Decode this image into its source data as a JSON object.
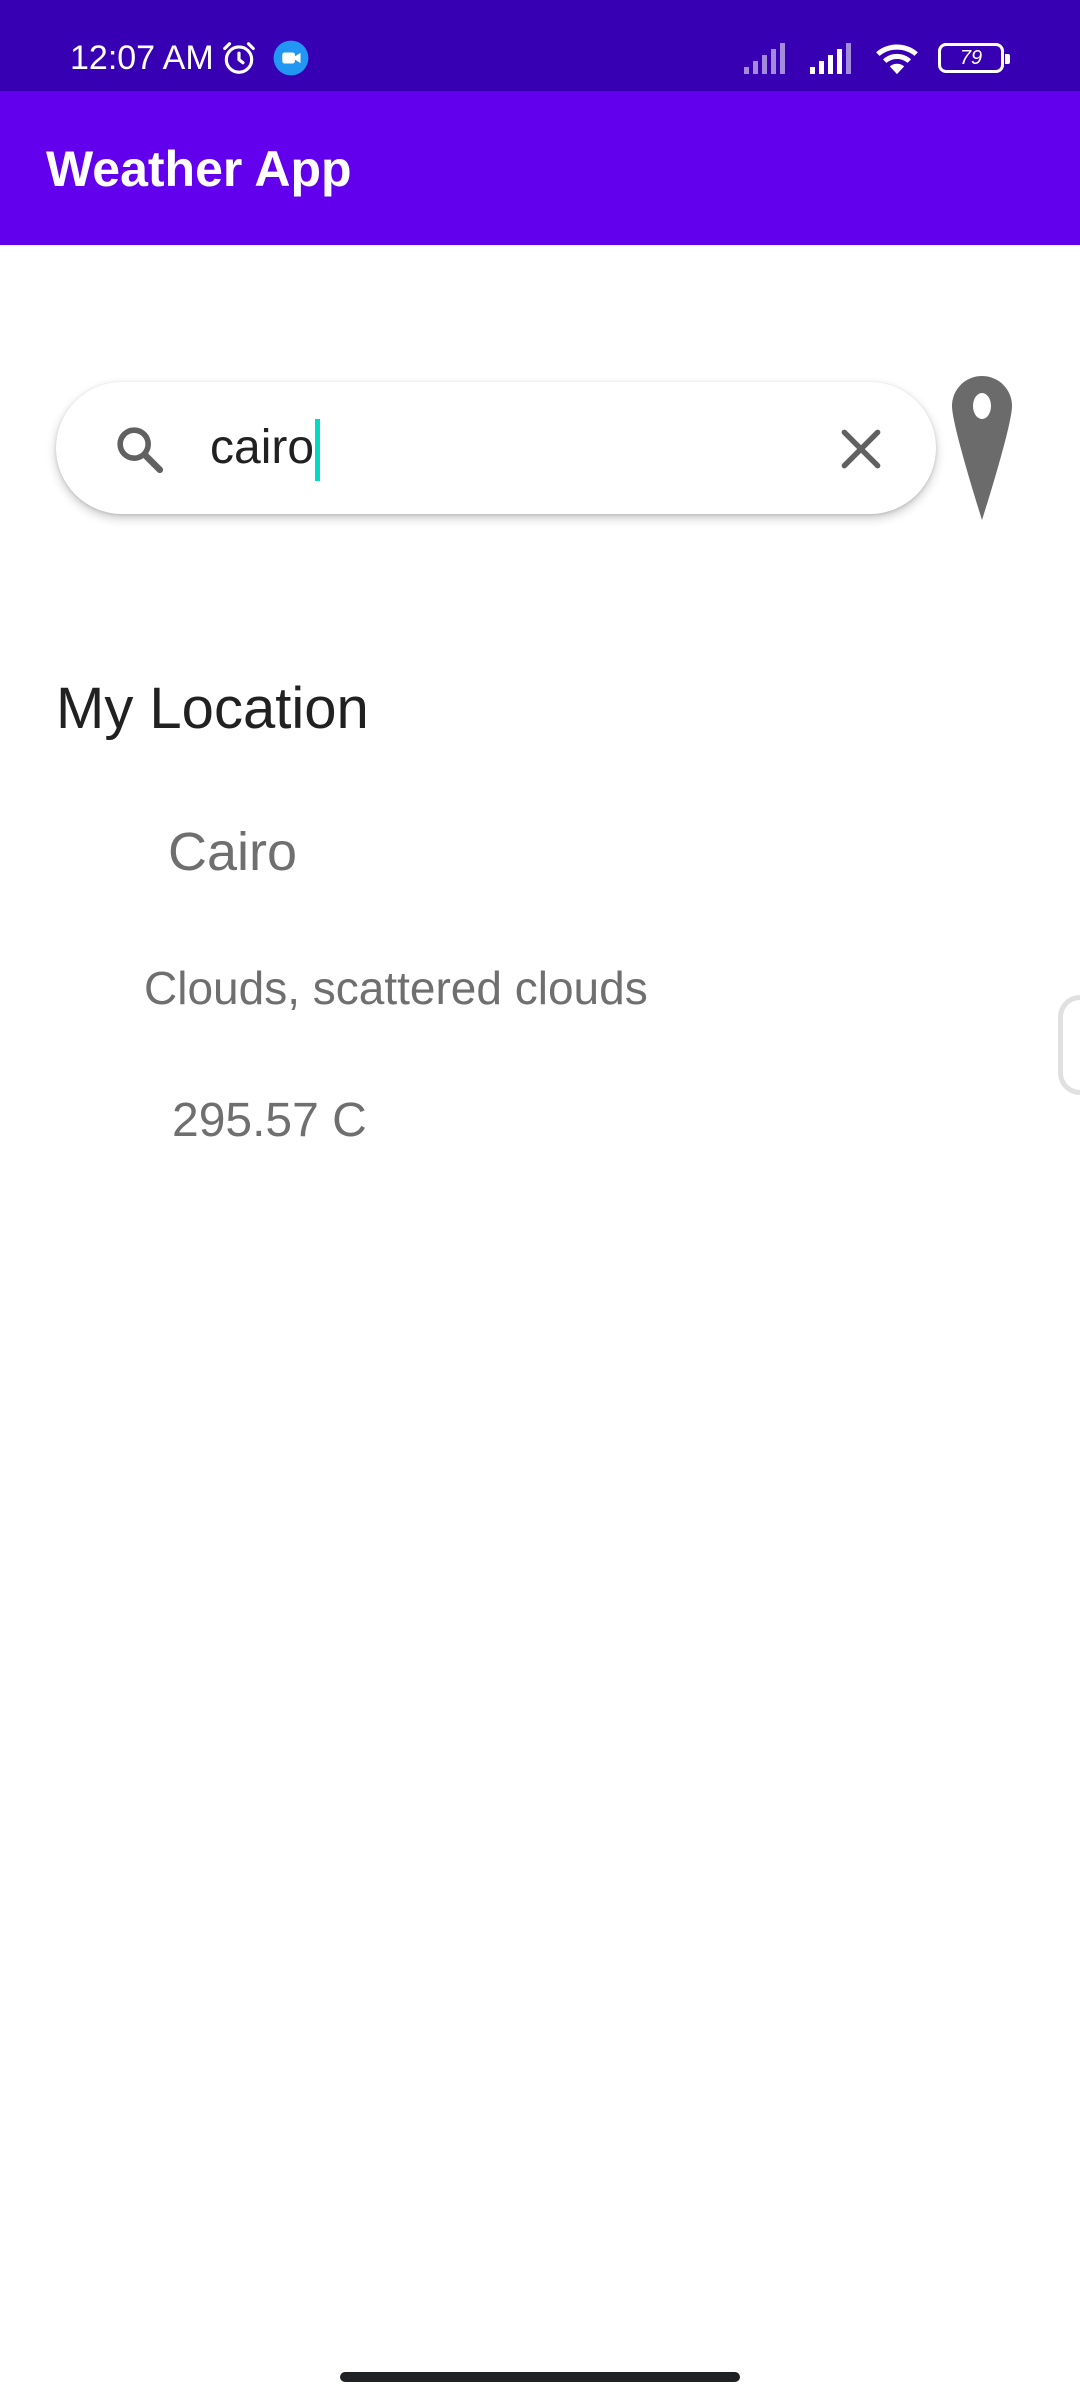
{
  "status_bar": {
    "time": "12:07 AM",
    "battery": "79",
    "icons": [
      "alarm-icon",
      "meet-icon",
      "signal-icon",
      "signal-icon",
      "wifi-icon",
      "battery-icon"
    ]
  },
  "app_bar": {
    "title": "Weather App"
  },
  "search": {
    "value": "cairo",
    "icons": [
      "search-icon",
      "clear-icon"
    ]
  },
  "location_button": {
    "icon": "map-pin-icon"
  },
  "main": {
    "section_title": "My Location",
    "city": "Cairo",
    "description": "Clouds, scattered clouds",
    "temperature": "295.57 C"
  },
  "colors": {
    "status_bar": "#3700b3",
    "app_bar": "#6200ee",
    "caret": "#03dac5",
    "text_secondary": "#6f6f6f"
  }
}
